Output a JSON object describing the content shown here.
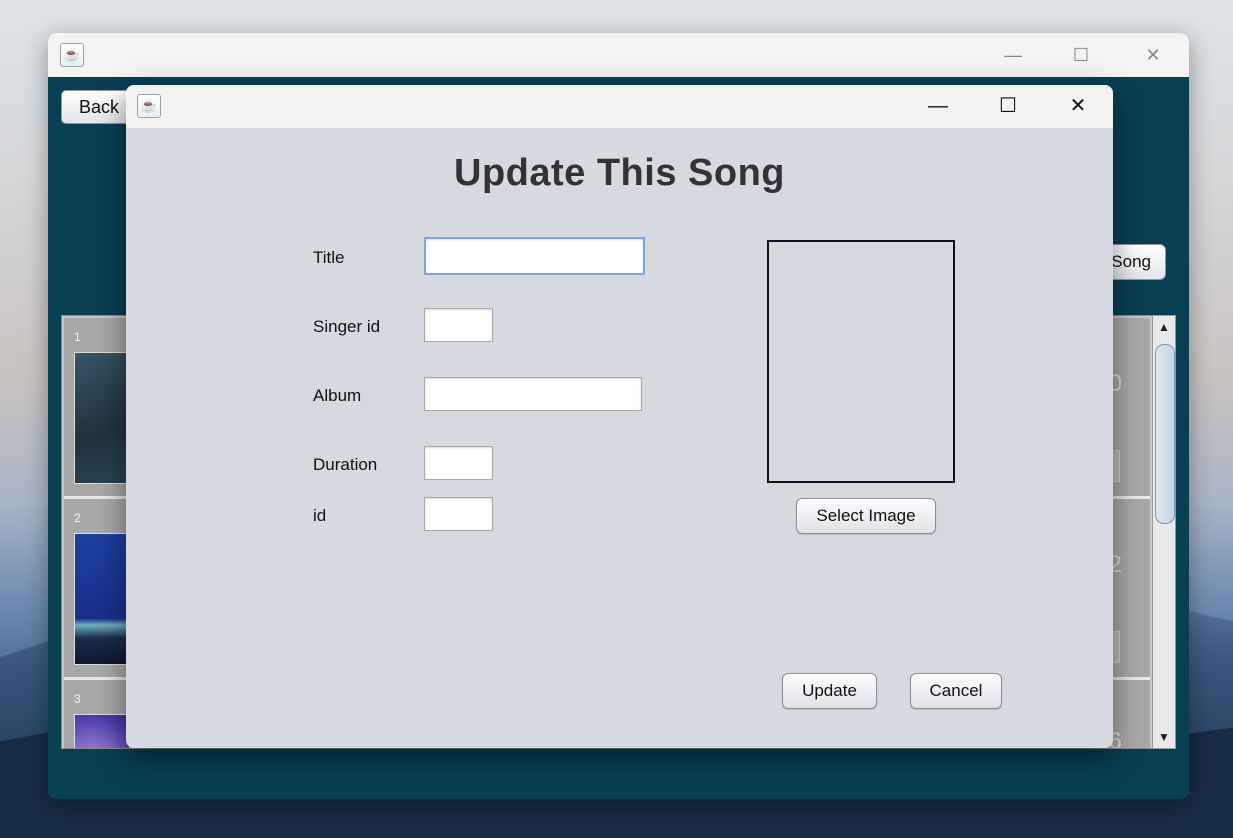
{
  "parent_window": {
    "back_label": "Back",
    "add_song_label": "Song",
    "rows": [
      {
        "num": "1",
        "right_value": "0"
      },
      {
        "num": "2",
        "right_value": "2"
      },
      {
        "num": "3",
        "right_value": "6"
      }
    ],
    "scroll_up": "▲",
    "scroll_down": "▼"
  },
  "dialog": {
    "heading": "Update This Song",
    "fields": {
      "title_label": "Title",
      "singer_id_label": "Singer id",
      "album_label": "Album",
      "duration_label": "Duration",
      "id_label": "id"
    },
    "select_image_label": "Select Image",
    "update_label": "Update",
    "cancel_label": "Cancel"
  },
  "icons": {
    "app": "java-cup-icon",
    "minimize": "minimize-icon",
    "maximize": "maximize-icon",
    "close": "close-icon"
  },
  "colors": {
    "parent_bg": "#083f52",
    "dialog_bg": "#d7d9e0",
    "focus_border": "#7ea6d8"
  }
}
